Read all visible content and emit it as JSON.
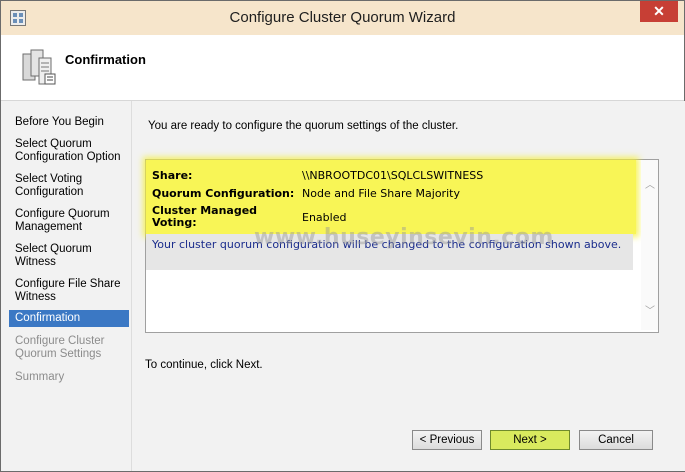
{
  "window": {
    "title": "Configure Cluster Quorum Wizard",
    "close_glyph": "✕"
  },
  "header": {
    "title": "Confirmation"
  },
  "nav": {
    "items": [
      {
        "label": "Before You Begin",
        "state": "normal"
      },
      {
        "label": "Select Quorum Configuration Option",
        "state": "normal"
      },
      {
        "label": "Select Voting Configuration",
        "state": "normal"
      },
      {
        "label": "Configure Quorum Management",
        "state": "normal"
      },
      {
        "label": "Select Quorum Witness",
        "state": "normal"
      },
      {
        "label": "Configure File Share Witness",
        "state": "normal"
      },
      {
        "label": "Confirmation",
        "state": "active"
      },
      {
        "label": "Configure Cluster Quorum Settings",
        "state": "disabled"
      },
      {
        "label": "Summary",
        "state": "disabled"
      }
    ]
  },
  "main": {
    "intro": "You are ready to configure the quorum settings of the cluster.",
    "summary": {
      "rows": [
        {
          "label": "Share:",
          "value": "\\\\NBROOTDC01\\SQLCLSWITNESS"
        },
        {
          "label": "Quorum Configuration:",
          "value": "Node and File Share Majority"
        },
        {
          "label": "Cluster Managed Voting:",
          "value": "Enabled"
        }
      ],
      "note": "Your cluster quorum configuration will be changed to the configuration shown above."
    },
    "watermark": "www.huseyinsevin.com",
    "continue_text": "To continue, click Next."
  },
  "buttons": {
    "previous": "< Previous",
    "next": "Next >",
    "cancel": "Cancel"
  },
  "colors": {
    "active_nav": "#3b78c4",
    "highlight": "#f8f556",
    "next_button": "#d9ea5e",
    "close_button": "#c73f35"
  },
  "icons": {
    "app": "wizard-app-icon",
    "header": "cluster-servers-icon"
  }
}
